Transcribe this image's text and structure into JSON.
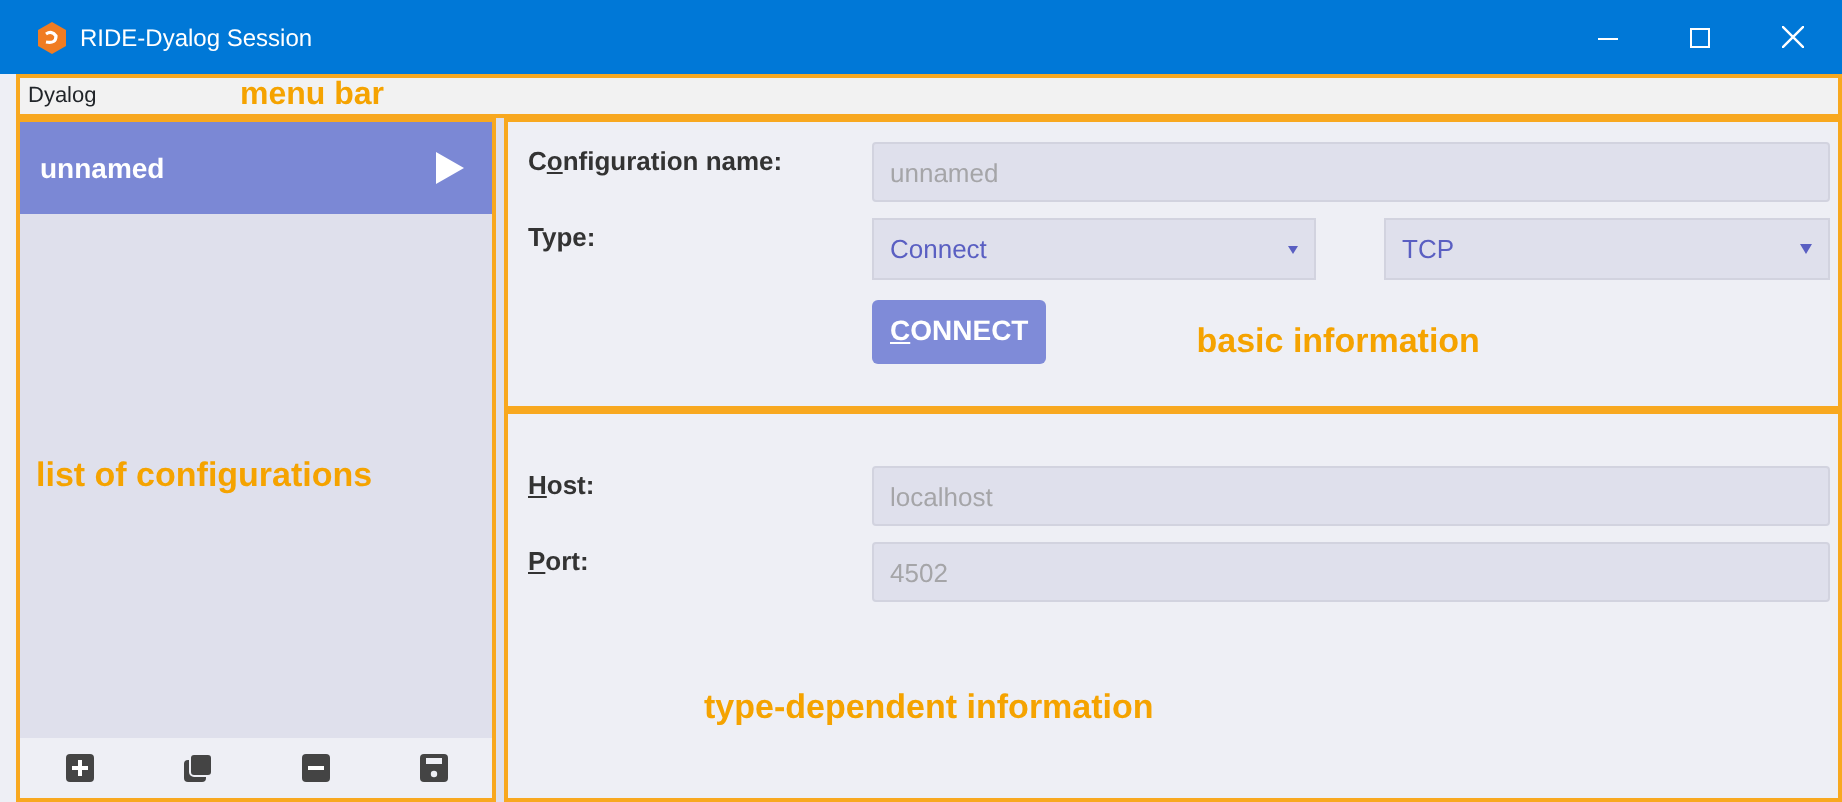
{
  "window": {
    "title": "RIDE-Dyalog Session"
  },
  "menu_bar": {
    "items": [
      "Dyalog"
    ],
    "annotation": "menu bar"
  },
  "sidebar": {
    "annotation": "list of configurations",
    "items": [
      {
        "label": "unnamed",
        "selected": true
      }
    ],
    "toolbar": [
      {
        "kind": "add"
      },
      {
        "kind": "duplicate"
      },
      {
        "kind": "remove"
      },
      {
        "kind": "save"
      }
    ]
  },
  "basic": {
    "annotation": "basic information",
    "name_label": {
      "lead": "C",
      "key": "o",
      "rest": "nfiguration name:"
    },
    "name_placeholder": "unnamed",
    "type_label": "Type:",
    "type_value": "Connect",
    "protocol_value": "TCP",
    "button": {
      "key": "C",
      "rest": "ONNECT"
    }
  },
  "details": {
    "annotation": "type-dependent information",
    "fields": [
      {
        "label_key": "H",
        "label_rest": "ost:",
        "placeholder": "localhost"
      },
      {
        "label_key": "P",
        "label_rest": "ort:",
        "placeholder": "4502"
      }
    ]
  }
}
